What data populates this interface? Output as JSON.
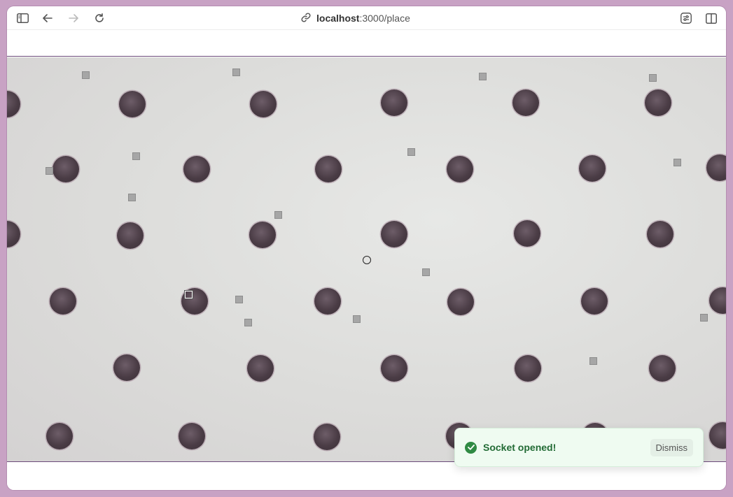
{
  "browser": {
    "url_host": "localhost",
    "url_path": ":3000/place",
    "icons": {
      "sidebar": "sidebar-icon",
      "back": "arrow-left-icon",
      "forward": "arrow-right-icon",
      "reload": "reload-icon",
      "link": "link-icon",
      "settings": "sliders-icon",
      "split": "split-view-icon"
    }
  },
  "toast": {
    "message": "Socket opened!",
    "dismiss_label": "Dismiss",
    "accent": "#2f8a43"
  }
}
